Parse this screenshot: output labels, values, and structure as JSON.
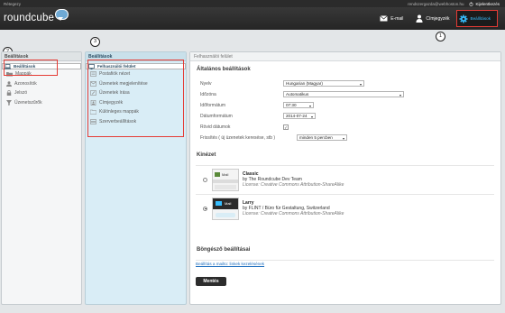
{
  "topline": {
    "brand": "Rétegezy",
    "user": "rendszergazda@webhoston.hu",
    "logout": "Kijelentkezés"
  },
  "app": {
    "logo_text": "roundcube"
  },
  "nav": {
    "email": "E-mail",
    "contacts": "Címjegyzék",
    "settings": "Beállítások"
  },
  "callouts": [
    "1",
    "2",
    "3"
  ],
  "left": {
    "header": "Beállítások",
    "items": [
      {
        "label": "Beállítások",
        "icon": "laptop-icon"
      },
      {
        "label": "Mappák",
        "icon": "folder-icon"
      },
      {
        "label": "Azonosítók",
        "icon": "person-icon"
      },
      {
        "label": "Jelszó",
        "icon": "lock-icon"
      },
      {
        "label": "Üzenetszűrők",
        "icon": "filter-icon"
      }
    ]
  },
  "mid": {
    "header": "Beállítások",
    "items": [
      "Felhasználói felület",
      "Postafiók nézet",
      "Üzenetek megjelenítése",
      "Üzenetek írása",
      "Címjegyzék",
      "Különleges mappák",
      "Szerverbeállítások"
    ]
  },
  "main": {
    "header": "Felhasználói felület",
    "section_general": "Általános beállítások",
    "rows": [
      {
        "label": "Nyelv",
        "value": "Hungarian (Magyar)"
      },
      {
        "label": "Időzóna",
        "value": "Automatikus"
      },
      {
        "label": "Időformátum",
        "value": "07:30"
      },
      {
        "label": "Dátumformátum",
        "value": "2014-07-24"
      },
      {
        "label": "Rövid dátumok",
        "value": "✓"
      },
      {
        "label": "Frissítés ( új üzenetek keresése, stb )",
        "value": "minden 5 percben"
      }
    ],
    "section_skin": "Kinézet",
    "skins": [
      {
        "name": "Classic",
        "author": "by The Roundcube Dev Team",
        "license": "License: Creative Commons Attribution-ShareAlike",
        "thumb_label": "Mail",
        "selected": false
      },
      {
        "name": "Larry",
        "author": "by FLINT / Büro für Gestaltung, Switzerland",
        "license": "License: Creative Commons Attribution-ShareAlike",
        "thumb_label": "Mail",
        "selected": true
      }
    ],
    "section_browser": "Böngésző beállításai",
    "link": "Beállítás a mailto: linkek kezelésének",
    "save": "Mentés"
  },
  "colors": {
    "accent": "#37beff",
    "highlight": "#e53b35",
    "topbar": "#2b2b2b"
  }
}
